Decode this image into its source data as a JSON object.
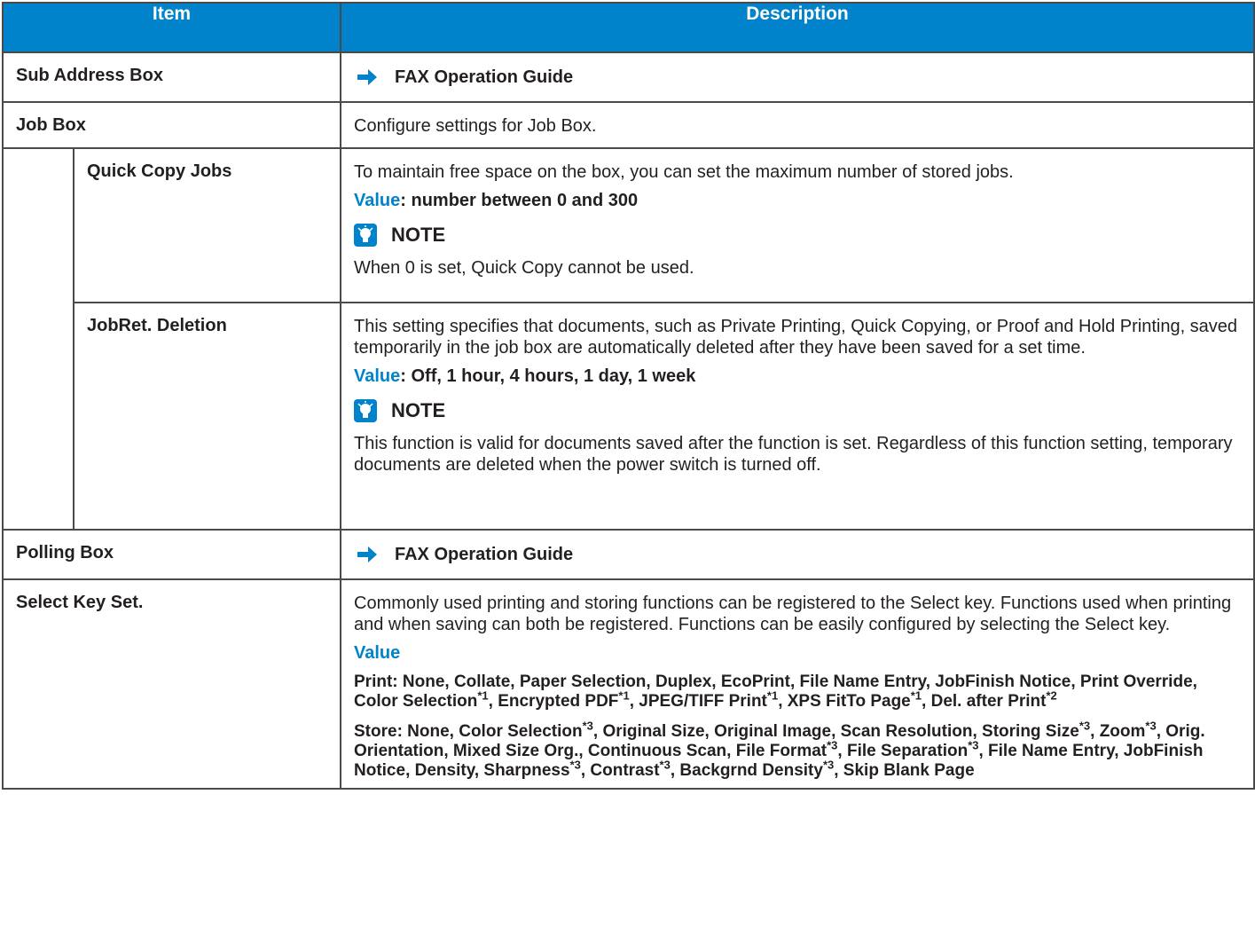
{
  "header": {
    "item": "Item",
    "description": "Description"
  },
  "rows": {
    "sub_address_box": {
      "label": "Sub Address Box",
      "ref": "FAX Operation Guide"
    },
    "job_box": {
      "label": "Job Box",
      "desc": "Configure settings for Job Box."
    },
    "quick_copy_jobs": {
      "label": "Quick Copy Jobs",
      "desc": "To maintain free space on the box, you can set the maximum number of stored jobs.",
      "value_label": "Value",
      "value_text": ": number between 0 and 300",
      "note_title": "NOTE",
      "note_text": "When 0 is set, Quick Copy cannot be used."
    },
    "jobret_deletion": {
      "label": "JobRet. Deletion",
      "desc": "This setting specifies that documents, such as Private Printing, Quick Copying, or Proof and Hold Printing, saved temporarily in the job box are automatically deleted after they have been saved for a set time.",
      "value_label": "Value",
      "value_text": ": Off, 1 hour, 4 hours, 1 day, 1 week",
      "note_title": "NOTE",
      "note_text": "This function is valid for documents saved after the function is set. Regardless of this function setting, temporary documents are deleted when the power switch is turned off."
    },
    "polling_box": {
      "label": "Polling Box",
      "ref": "FAX Operation Guide"
    },
    "select_key_set": {
      "label": "Select Key Set.",
      "desc": "Commonly used printing and storing functions can be registered to the Select key. Functions used when printing and when saving can both be registered. Functions can be easily configured by selecting the Select key.",
      "value_label": "Value",
      "print": {
        "t1": "Print: None, Collate, Paper Selection, Duplex, EcoPrint, File Name Entry, JobFinish Notice, Print Override, Color Selection",
        "s1": "*1",
        "t2": ", Encrypted PDF",
        "s2": "*1",
        "t3": ", JPEG/TIFF Print",
        "s3": "*1",
        "t4": ", XPS FitTo Page",
        "s4": "*1",
        "t5": ", Del. after Print",
        "s5": "*2"
      },
      "store": {
        "t1": "Store: None, Color Selection",
        "s1": "*3",
        "t2": ", Original Size, Original Image, Scan Resolution, Storing Size",
        "s2": "*3",
        "t3": ", Zoom",
        "s3": "*3",
        "t4": ", Orig. Orientation, Mixed Size Org., Continuous Scan, File Format",
        "s4": "*3",
        "t5": ", File Separation",
        "s5": "*3",
        "t6": ", File Name Entry, JobFinish Notice, Density, Sharpness",
        "s6": "*3",
        "t7": ", Contrast",
        "s7": "*3",
        "t8": ", Backgrnd Density",
        "s8": "*3",
        "t9": ", Skip Blank Page"
      }
    }
  },
  "colors": {
    "header_bg": "#0083ca",
    "accent": "#0083ca",
    "border": "#4a4a4a"
  },
  "icons": {
    "reference": "arrow-right-icon",
    "note": "note-bulb-icon"
  }
}
